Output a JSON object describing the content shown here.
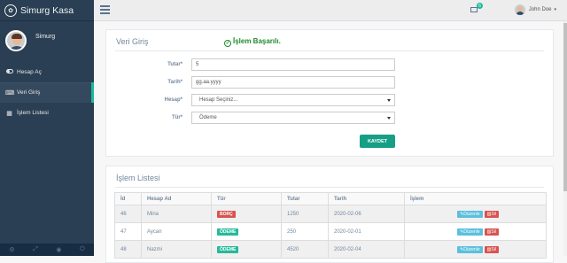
{
  "brand": {
    "title": "Simurg Kasa"
  },
  "profile": {
    "name": "Simurg"
  },
  "sidebar": {
    "items": [
      {
        "label": "Hesap Aç",
        "icon": "toggle-icon"
      },
      {
        "label": "Veri Giriş",
        "icon": "keyboard-icon"
      },
      {
        "label": "İşlem Listesi",
        "icon": "table-icon"
      }
    ],
    "footer_icons": [
      "settings-icon",
      "fullscreen-icon",
      "eye-slash-icon",
      "power-icon"
    ]
  },
  "topbar": {
    "notification_count": "6",
    "user_name": "John Doe"
  },
  "form_panel": {
    "title": "Veri Giriş",
    "success_message": "İşlem Başarılı.",
    "fields": {
      "amount": {
        "label": "Tutar",
        "value": "5"
      },
      "date": {
        "label": "Tarih",
        "value": "gg.aa.yyyy"
      },
      "account": {
        "label": "Hesap",
        "value": "Hesap Seçiniz..."
      },
      "type": {
        "label": "Tür",
        "value": "Ödeme"
      }
    },
    "save_label": "KAYDET"
  },
  "list_panel": {
    "title": "İşlem Listesi",
    "headers": [
      "İd",
      "Hesap Ad",
      "Tür",
      "Tutar",
      "Tarih",
      "İşlem"
    ],
    "rows": [
      {
        "id": "46",
        "account": "Mina",
        "type": "BORÇ",
        "amount": "1250",
        "date": "2020-02-06"
      },
      {
        "id": "47",
        "account": "Aycan",
        "type": "ÖDEME",
        "amount": "250",
        "date": "2020-02-01"
      },
      {
        "id": "48",
        "account": "Nazmi",
        "type": "ÖDEME",
        "amount": "4520",
        "date": "2020-02-04"
      }
    ],
    "edit_label": "Düzenle",
    "delete_label": "Sil"
  },
  "colors": {
    "sidebar": "#2a3f54",
    "accent": "#1abb9c",
    "save": "#169f85",
    "danger": "#d9534f",
    "info": "#5bc0de"
  }
}
